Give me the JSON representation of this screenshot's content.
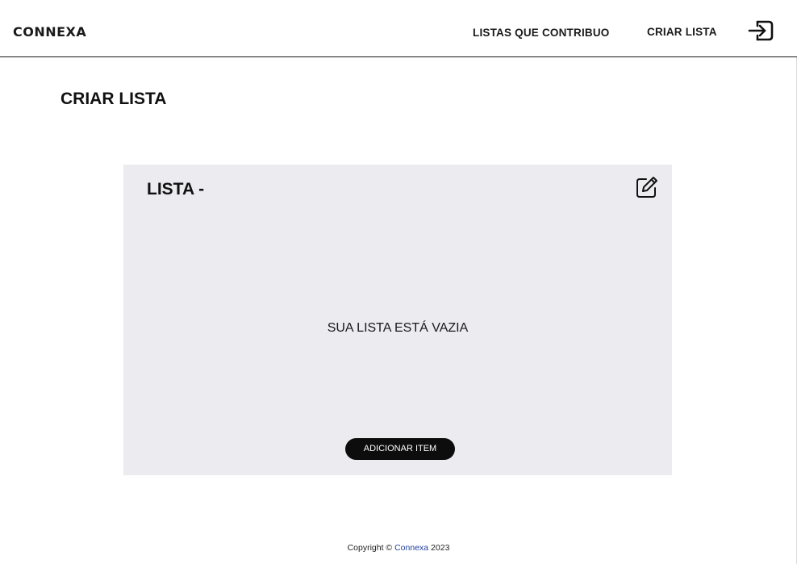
{
  "header": {
    "logo_text": "CONNEXA",
    "nav": {
      "contributions_label": "LISTAS QUE CONTRIBUO",
      "create_label": "CRIAR LISTA"
    },
    "logout_icon": "logout-icon"
  },
  "main": {
    "page_title": "CRIAR LISTA",
    "list_card": {
      "title": "LISTA -",
      "edit_icon": "edit-icon",
      "empty_message": "SUA LISTA ESTÁ VAZIA",
      "add_item_label": "ADICIONAR ITEM",
      "background_color": "#ebebf0"
    }
  },
  "footer": {
    "prefix": "Copyright ©",
    "brand_link": "Connexa",
    "year": "2023",
    "link_color": "#1f3f9e"
  },
  "colors": {
    "button_bg": "#0d0d0d",
    "text": "#111111"
  }
}
